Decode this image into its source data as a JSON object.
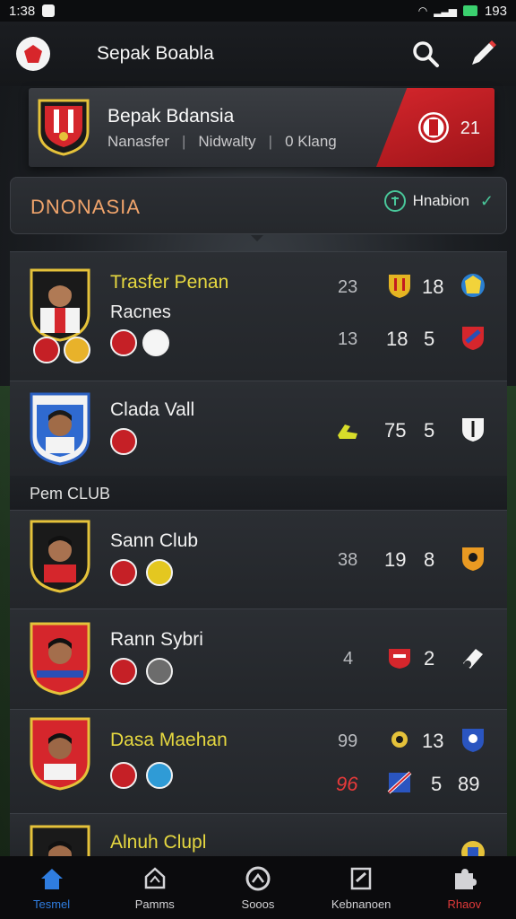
{
  "status_bar": {
    "time": "1:38",
    "battery": "193"
  },
  "app_bar": {
    "title": "Sepak Boabla"
  },
  "hero": {
    "title": "Bepak Bdansia",
    "tabs": [
      "Nanasfer",
      "Nidwalty",
      "0 Klang"
    ],
    "score": "21"
  },
  "section": {
    "title": "DNONASIA",
    "filter_label": "Hnabion"
  },
  "players": [
    {
      "name": "Trasfer Penan",
      "sub": "Racnes",
      "stats_top": [
        "23",
        "18"
      ],
      "stats_bottom": [
        "13",
        "18",
        "5"
      ]
    },
    {
      "name": "Clada Vall",
      "stats": [
        "75",
        "5"
      ]
    }
  ],
  "divider": {
    "label": "Pem CLUB"
  },
  "clubs": [
    {
      "name": "Sann Club",
      "stats": [
        "38",
        "19",
        "8"
      ]
    },
    {
      "name": "Rann Sybri",
      "stats": [
        "4",
        "2"
      ]
    },
    {
      "name": "Dasa Maehan",
      "stats_top": [
        "99",
        "13"
      ],
      "stats_bottom": [
        "96",
        "5",
        "89"
      ]
    },
    {
      "name": "Alnuh Clupl"
    }
  ],
  "bottom_nav": [
    {
      "label": "Tesmel",
      "icon": "home-icon",
      "state": "active"
    },
    {
      "label": "Pamms",
      "icon": "shield-icon",
      "state": "normal"
    },
    {
      "label": "Sooos",
      "icon": "ball-icon",
      "state": "normal"
    },
    {
      "label": "Kebnanoen",
      "icon": "document-icon",
      "state": "normal"
    },
    {
      "label": "Rhaov",
      "icon": "puzzle-icon",
      "state": "alert"
    }
  ],
  "colors": {
    "accent_blue": "#2f7de0",
    "brand_red": "#d5262c",
    "highlight_yellow": "#e6d840",
    "section_orange": "#f0a46b",
    "filter_green": "#49c79a"
  }
}
